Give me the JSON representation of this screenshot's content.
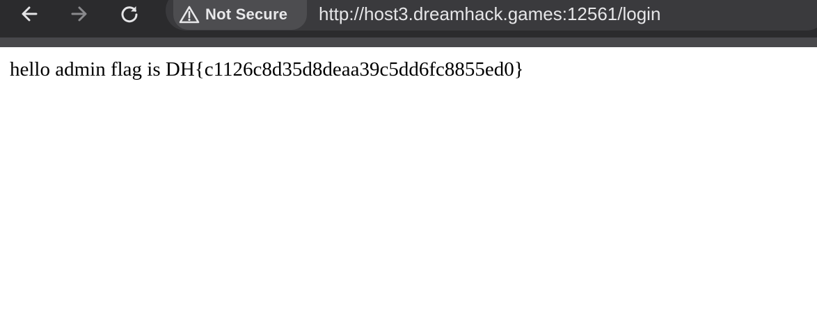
{
  "browser": {
    "security_label": "Not Secure",
    "url": "http://host3.dreamhack.games:12561/login",
    "icons": {
      "back": "arrow-left-icon",
      "forward": "arrow-right-icon",
      "reload": "reload-icon",
      "security": "warning-triangle-icon"
    }
  },
  "page": {
    "message": "hello admin flag is DH{c1126c8d35d8deaa39c5dd6fc8855ed0}"
  }
}
